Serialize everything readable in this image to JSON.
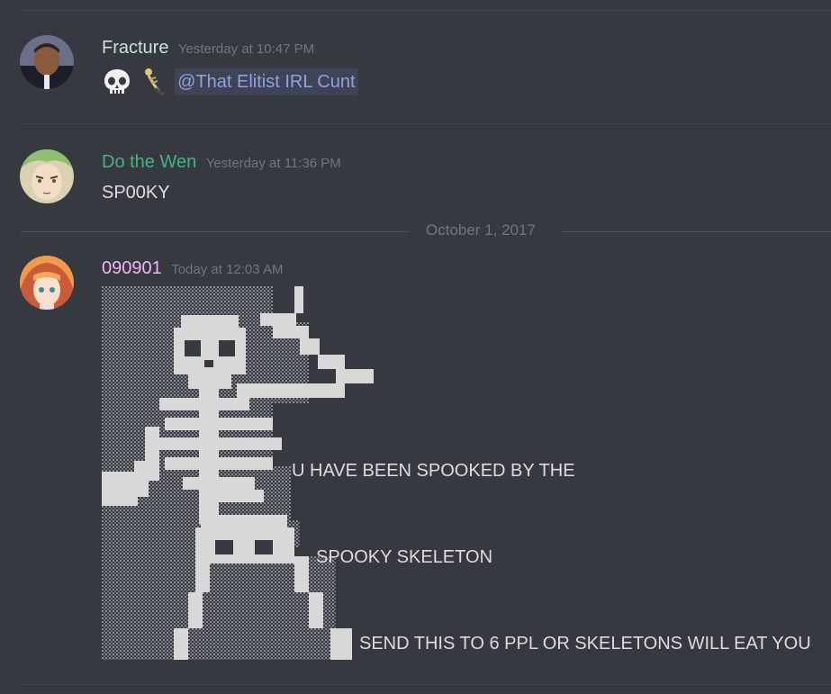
{
  "messages": [
    {
      "author": "Fracture",
      "author_color": "#c9e3d4",
      "timestamp": "Yesterday at 10:47 PM",
      "emojis": [
        "skull-icon",
        "skeleton-icon"
      ],
      "mention": "@That Elitist IRL Cunt"
    },
    {
      "author": "Do the Wen",
      "author_color": "#43b581",
      "timestamp": "Yesterday at 11:36 PM",
      "text": "SP00KY"
    },
    {
      "author": "090901",
      "author_color": "#f3b4f7",
      "timestamp": "Today at 12:03 AM",
      "lines": [
        "U HAVE BEEN SPOOKED BY THE",
        "SPOOKY SKELETON",
        "SEND THIS TO 6 PPL OR SKELETONS WILL EAT YOU"
      ]
    }
  ],
  "date_separator": "October 1, 2017"
}
